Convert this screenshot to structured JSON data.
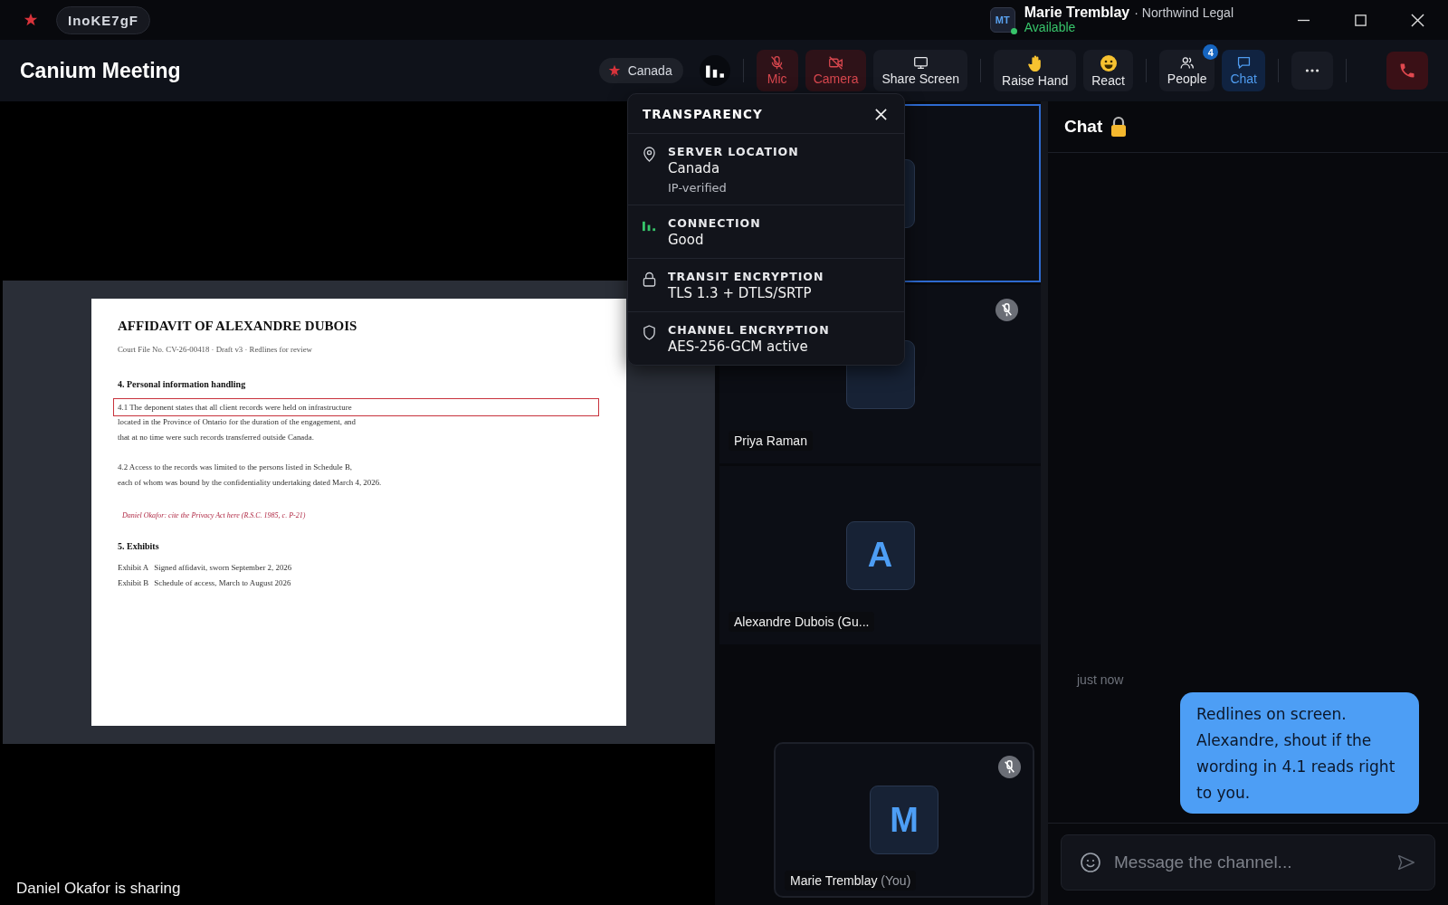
{
  "titlebar": {
    "room_code": "InoKE7gF",
    "user": {
      "initials": "MT",
      "name": "Marie Tremblay",
      "org": "· Northwind Legal",
      "status": "Available",
      "online": true
    }
  },
  "header": {
    "title": "Canium Meeting",
    "region": "Canada",
    "controls": [
      {
        "kind": "signal"
      },
      {
        "kind": "mic",
        "label": "Mic",
        "on": false
      },
      {
        "kind": "camera",
        "label": "Camera",
        "on": false
      },
      {
        "kind": "share",
        "label": "Share Screen"
      },
      {
        "kind": "hand",
        "label": "Raise Hand"
      },
      {
        "kind": "react",
        "label": "React"
      },
      {
        "kind": "people",
        "label": "People",
        "badge": "4"
      },
      {
        "kind": "chat",
        "label": "Chat",
        "selected": true
      },
      {
        "kind": "more"
      },
      {
        "kind": "end"
      }
    ]
  },
  "transparency": {
    "title": "TRANSPARENCY",
    "items": [
      {
        "kind": "location",
        "label": "SERVER LOCATION",
        "value": "Canada",
        "note": "IP-verified"
      },
      {
        "kind": "connection",
        "label": "CONNECTION",
        "value": "Good"
      },
      {
        "kind": "lock",
        "label": "TRANSIT ENCRYPTION",
        "value": "TLS 1.3 + DTLS/SRTP"
      },
      {
        "kind": "shield",
        "label": "CHANNEL ENCRYPTION",
        "value": "AES-256-GCM active"
      }
    ]
  },
  "share": {
    "caption": "Daniel Okafor is sharing",
    "document": {
      "title": "AFFIDAVIT OF ALEXANDRE DUBOIS",
      "meta": "Court File No. CV-26-00418  ·  Draft v3  ·  Redlines for review",
      "blocks": [
        {
          "kind": "heading",
          "text": "4.  Personal information handling"
        },
        {
          "kind": "para",
          "lines": [
            {
              "text": "4.1  The deponent states that all client records were held on infrastructure",
              "highlighted": true
            },
            {
              "text": "located in the Province of Ontario for the duration of the engagement, and",
              "highlighted": false
            },
            {
              "text": "that at no time were such records transferred outside Canada.",
              "highlighted": false
            }
          ]
        },
        {
          "kind": "para",
          "lines": [
            {
              "text": "4.2  Access to the records was limited to the persons listed in Schedule B,",
              "highlighted": false
            },
            {
              "text": "each of whom was bound by the confidentiality undertaking dated March 4, 2026.",
              "highlighted": false
            }
          ]
        },
        {
          "kind": "comment",
          "text": "Daniel Okafor: cite the Privacy Act here (R.S.C. 1985, c. P-21)"
        },
        {
          "kind": "heading",
          "text": "5.  Exhibits"
        },
        {
          "kind": "exhibit",
          "label": "Exhibit A",
          "text": "Signed affidavit, sworn September 2, 2026"
        },
        {
          "kind": "exhibit",
          "label": "Exhibit B",
          "text": "Schedule of access, March to August 2026"
        }
      ]
    }
  },
  "tiles": [
    {
      "kind": "remote",
      "speaking": true
    },
    {
      "kind": "remote",
      "name": "Priya Raman",
      "speaking": false,
      "muted": true
    },
    {
      "kind": "remote",
      "initial": "A",
      "name": "Alexandre Dubois (Gu...",
      "speaking": false,
      "muted": false
    },
    {
      "kind": "self",
      "initial": "M",
      "name": "Marie Tremblay",
      "suffix": "(You)",
      "speaking": false,
      "muted": true
    }
  ],
  "chat": {
    "title": "Chat",
    "locked": true,
    "messages": [
      {
        "kind": "outgoing",
        "time": "just now",
        "text": "Redlines on screen. Alexandre, shout if the wording in 4.1 reads right to you."
      }
    ],
    "input": {
      "placeholder": "Message the channel..."
    }
  }
}
